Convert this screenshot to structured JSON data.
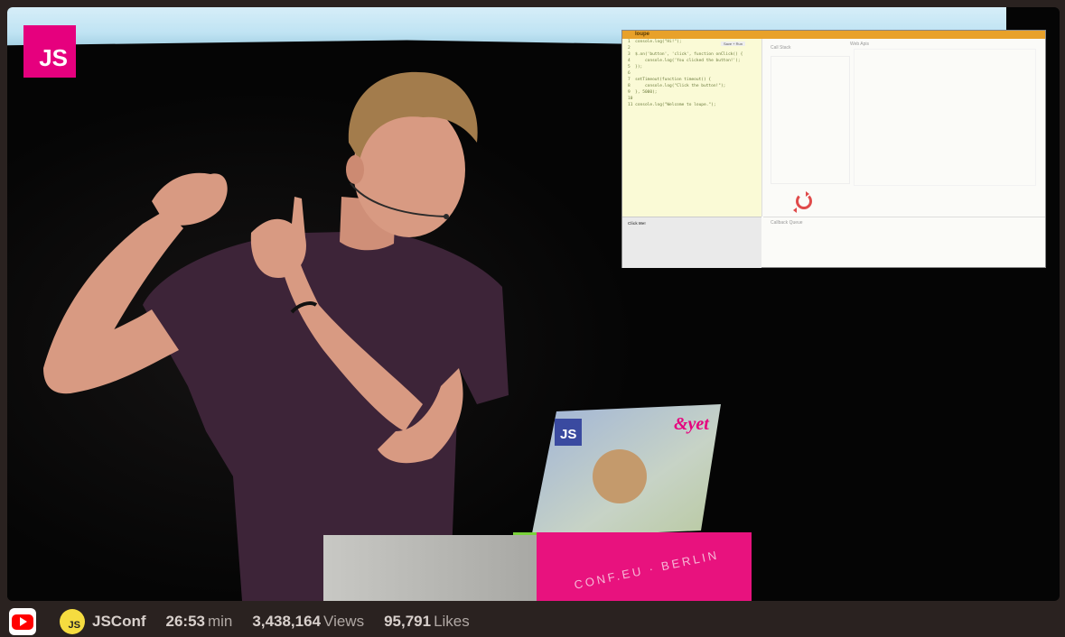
{
  "video": {
    "badge_text": "JS",
    "demo_window": {
      "title": "loupe",
      "run_tag": "Save + Run",
      "code_lines": [
        "1  console.log(\"Hi!\");",
        "2",
        "3  $.on('button', 'click', function onClick() {",
        "4      console.log('You clicked the button!');",
        "5  });",
        "6",
        "7  setTimeout(function timeout() {",
        "8      console.log(\"Click the button!\");",
        "9  }, 5000);",
        "10",
        "11 console.log(\"Welcome to loupe.\");"
      ],
      "call_stack_label": "Call Stack",
      "web_apis_label": "Web Apis",
      "callback_queue_label": "Callback Queue",
      "edit_label": "Click Me!"
    },
    "laptop_stickers": [
      "JS",
      "&yet"
    ],
    "podium_text": "CONF.EU · BERLIN"
  },
  "bottom_bar": {
    "channel_name": "JSConf",
    "channel_avatar_text": "JS",
    "duration_value": "26:53",
    "duration_unit": "min",
    "views_value": "3,438,164",
    "views_unit": "Views",
    "likes_value": "95,791",
    "likes_unit": "Likes"
  },
  "colors": {
    "youtube_red": "#ff0000",
    "brand_pink": "#e6007e",
    "avatar_yellow": "#f5dc40",
    "demo_titlebar": "#e8a12a"
  }
}
